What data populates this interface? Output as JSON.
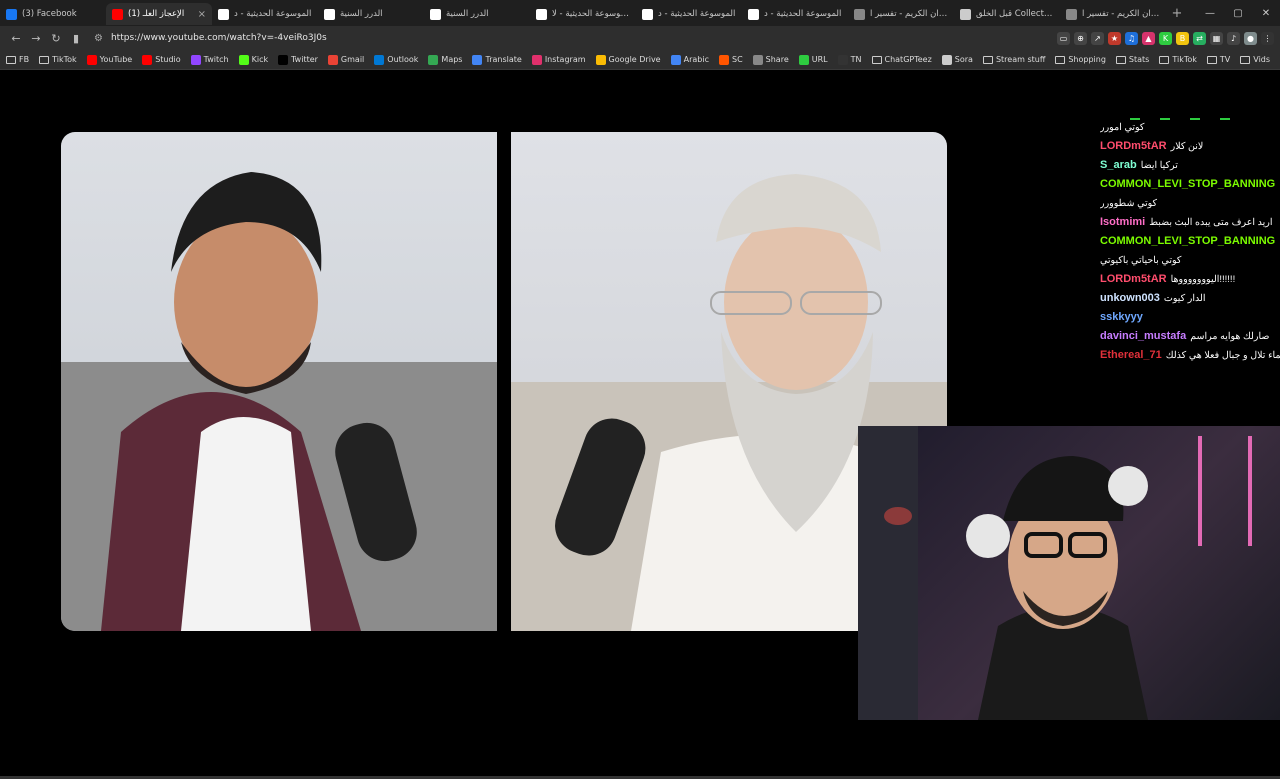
{
  "tabs": [
    {
      "title": "(3) Facebook",
      "color": "#1877f2",
      "active": false
    },
    {
      "title": "(1) الإعجاز العلـ",
      "color": "#ff0000",
      "active": true
    },
    {
      "title": "الموسوعة الحديثية - د",
      "color": "#ffffff",
      "active": false
    },
    {
      "title": "الدرر السنية",
      "color": "#ffffff",
      "active": false
    },
    {
      "title": "الدرر السنية",
      "color": "#ffffff",
      "active": false
    },
    {
      "title": "الموسوعة الحديثية - لا",
      "color": "#ffffff",
      "active": false
    },
    {
      "title": "الموسوعة الحديثية - د",
      "color": "#ffffff",
      "active": false
    },
    {
      "title": "الموسوعة الحديثية - د",
      "color": "#ffffff",
      "active": false
    },
    {
      "title": "القرآن الكريم - تفسير ا",
      "color": "#888888",
      "active": false
    },
    {
      "title": "قبل الخلق Collection",
      "color": "#cccccc",
      "active": false
    },
    {
      "title": "القرآن الكريم - تفسير ا",
      "color": "#888888",
      "active": false
    }
  ],
  "tab_close": "×",
  "new_tab": "+",
  "window_controls": [
    "—",
    "▢",
    "✕"
  ],
  "url": "https://www.youtube.com/watch?v=-4veiRo3J0s",
  "bookmarks": [
    {
      "label": "FB",
      "type": "folder"
    },
    {
      "label": "TikTok",
      "type": "folder"
    },
    {
      "label": "YouTube",
      "type": "icon",
      "color": "#ff0000"
    },
    {
      "label": "Studio",
      "type": "icon",
      "color": "#ff0000"
    },
    {
      "label": "Twitch",
      "type": "icon",
      "color": "#9146ff"
    },
    {
      "label": "Kick",
      "type": "icon",
      "color": "#53fc18"
    },
    {
      "label": "Twitter",
      "type": "icon",
      "color": "#000000"
    },
    {
      "label": "Gmail",
      "type": "icon",
      "color": "#ea4335"
    },
    {
      "label": "Outlook",
      "type": "icon",
      "color": "#0078d4"
    },
    {
      "label": "Maps",
      "type": "icon",
      "color": "#34a853"
    },
    {
      "label": "Translate",
      "type": "icon",
      "color": "#4285f4"
    },
    {
      "label": "Instagram",
      "type": "icon",
      "color": "#e1306c"
    },
    {
      "label": "Google Drive",
      "type": "icon",
      "color": "#fbbc04"
    },
    {
      "label": "Arabic",
      "type": "icon",
      "color": "#4285f4"
    },
    {
      "label": "SC",
      "type": "icon",
      "color": "#ff5500"
    },
    {
      "label": "Share",
      "type": "icon",
      "color": "#888888"
    },
    {
      "label": "URL",
      "type": "icon",
      "color": "#2ecc40"
    },
    {
      "label": "TN",
      "type": "icon",
      "color": "#333333"
    },
    {
      "label": "ChatGPTeez",
      "type": "folder"
    },
    {
      "label": "Sora",
      "type": "icon",
      "color": "#cccccc"
    },
    {
      "label": "Stream stuff",
      "type": "folder"
    },
    {
      "label": "Shopping",
      "type": "folder"
    },
    {
      "label": "Stats",
      "type": "folder"
    },
    {
      "label": "TikTok",
      "type": "folder"
    },
    {
      "label": "TV",
      "type": "folder"
    },
    {
      "label": "Vids",
      "type": "folder"
    }
  ],
  "chat": [
    {
      "name": "",
      "color": "#ffffff",
      "msg": "كوتي امورر"
    },
    {
      "name": "LORDm5tAR",
      "color": "#ff4d6d",
      "msg": "لانن كلار"
    },
    {
      "name": "S_arab",
      "color": "#7fffd4",
      "msg": "تركيا ايضا"
    },
    {
      "name": "COMMON_LEVI_STOP_BANNING",
      "color": "#7cfc00",
      "msg": ""
    },
    {
      "name": "",
      "color": "#ffffff",
      "msg": "كوتي شطوورر"
    },
    {
      "name": "Isotmimi",
      "color": "#ff6ec7",
      "msg": "اريد اعرف متى يبده البث بضبط"
    },
    {
      "name": "COMMON_LEVI_STOP_BANNING",
      "color": "#7cfc00",
      "msg": ""
    },
    {
      "name": "",
      "color": "#ffffff",
      "msg": "كوتي باحياتي باكيوتي"
    },
    {
      "name": "LORDm5tAR",
      "color": "#ff4d6d",
      "msg": "اليوووووووها!!!!!!"
    },
    {
      "name": "unkown003",
      "color": "#cfe3ff",
      "msg": "الدار كيوت"
    },
    {
      "name": "sskkyyy",
      "color": "#6fa8ff",
      "msg": ""
    },
    {
      "name": "davinci_mustafa",
      "color": "#c77dff",
      "msg": "صارلك هوايه مراسم"
    },
    {
      "name": "Ethereal_71",
      "color": "#e0303a",
      "msg": "اليابان جزر والجزر تعتبر في الماء تلال و جبال فعلا هي كذلك"
    }
  ]
}
